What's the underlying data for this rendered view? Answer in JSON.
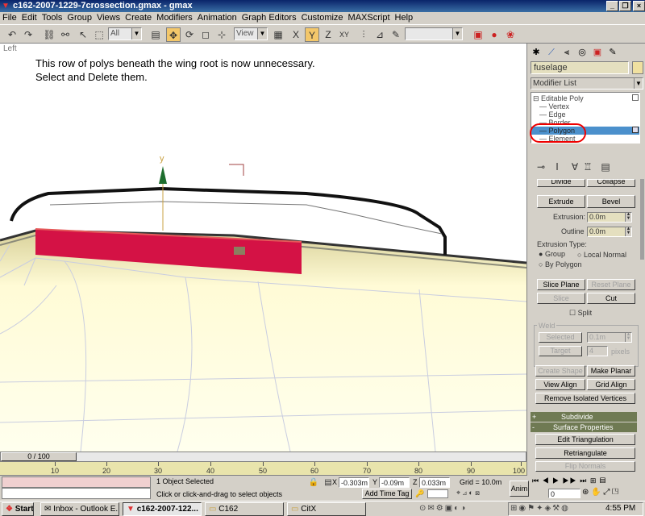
{
  "window": {
    "title": "c162-2007-1229-7crossection.gmax - gmax",
    "minimize_icon": "minimize-icon",
    "maximize_icon": "restore-icon",
    "close_icon": "close-icon"
  },
  "menu": [
    "File",
    "Edit",
    "Tools",
    "Group",
    "Views",
    "Create",
    "Modifiers",
    "Animation",
    "Graph Editors",
    "Customize",
    "MAXScript",
    "Help"
  ],
  "toolbar": {
    "selection_filter": "All",
    "reference_coord": "View",
    "named_selection": ""
  },
  "viewport": {
    "label": "Left",
    "instruction_line1": "This row of polys beneath the wing root is now unnecessary.",
    "instruction_line2": "Select and Delete them.",
    "gizmo_axis_label": "y",
    "colors": {
      "selection": "#d41245",
      "highlight": "#e55a5a",
      "fuselage": "#fffbd6"
    }
  },
  "command_panel": {
    "object_name": "fuselage",
    "object_color": "#f0e0a0",
    "modifier_list": "Modifier List",
    "stack": [
      "Editable Poly",
      "Vertex",
      "Edge",
      "Border",
      "Polygon",
      "Element"
    ],
    "selected_subobject": "Polygon",
    "buttons": {
      "divide": "Divide",
      "collapse": "Collapse",
      "extrude": "Extrude",
      "bevel": "Bevel",
      "slice_plane": "Slice Plane",
      "reset_plane": "Reset Plane",
      "slice": "Slice",
      "cut": "Cut",
      "selected": "Selected",
      "target": "Target",
      "create_shape": "Create Shape",
      "make_planar": "Make Planar",
      "view_align": "View Align",
      "grid_align": "Grid Align",
      "remove_isolated": "Remove Isolated Vertices",
      "edit_triangulation": "Edit Triangulation",
      "retriangulate": "Retriangulate",
      "flip_normals": "Flip Normals"
    },
    "labels": {
      "extrusion": "Extrusion:",
      "outline": "Outline",
      "extrusion_type": "Extrusion Type:",
      "group": "Group",
      "local_normal": "Local Normal",
      "by_polygon": "By Polygon",
      "split": "Split",
      "weld": "Weld",
      "pixels": "pixels"
    },
    "values": {
      "extrusion": "0.0m",
      "outline": "0.0m",
      "weld_selected": "0.1m",
      "weld_target": "4"
    },
    "rollouts": {
      "subdivide": "Subdivide",
      "surface_properties": "Surface Properties",
      "subdivide_sign": "+",
      "surface_sign": "-"
    }
  },
  "timeline": {
    "frame_label": "0 / 100",
    "ticks": [
      "10",
      "20",
      "30",
      "40",
      "50",
      "60",
      "70",
      "80",
      "90",
      "100"
    ]
  },
  "status": {
    "selection": "1 Object Selected",
    "prompt": "Click or click-and-drag to select objects",
    "x_label": "X",
    "x": "-0.303m",
    "y_label": "Y",
    "y": "-0.09m",
    "z_label": "Z",
    "z": "0.033m",
    "grid": "Grid = 10.0m",
    "add_time_tag": "Add Time Tag",
    "anim": "Anim",
    "frame_value": "0"
  },
  "taskbar": {
    "start": "Start",
    "tasks": [
      "Inbox - Outlook E...",
      "c162-2007-122...",
      "C162",
      "CitX"
    ],
    "clock": "4:55 PM"
  }
}
